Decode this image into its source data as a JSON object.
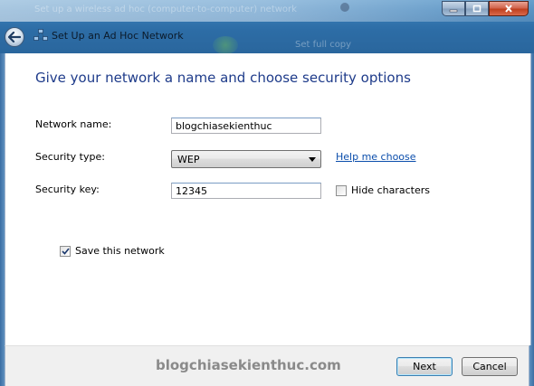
{
  "window": {
    "title": "Set Up an Ad Hoc Network",
    "background_text_1": "Set up a wireless ad hoc (computer-to-computer) network",
    "background_text_2": "Set full copy"
  },
  "wizard": {
    "heading": "Give your network a name and choose security options",
    "network_name_label": "Network name:",
    "network_name_value": "blogchiasekienthuc",
    "security_type_label": "Security type:",
    "security_type_value": "WEP",
    "help_link": "Help me choose",
    "security_key_label": "Security key:",
    "security_key_value": "12345",
    "hide_characters_label": "Hide characters",
    "hide_characters_checked": false,
    "save_network_label": "Save this network",
    "save_network_checked": true
  },
  "footer": {
    "watermark": "blogchiasekienthuc.com",
    "next_label": "Next",
    "cancel_label": "Cancel"
  },
  "colors": {
    "heading": "#1e3b8a",
    "link": "#0a4dab",
    "glass": "#2d6da6"
  }
}
